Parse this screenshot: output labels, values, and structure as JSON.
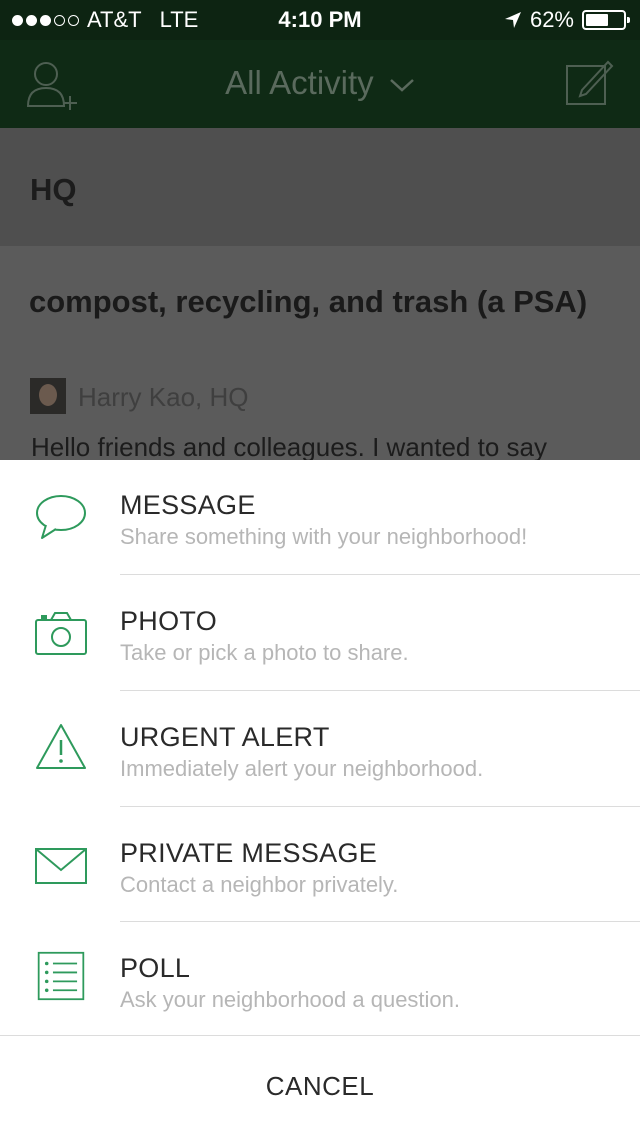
{
  "status_bar": {
    "carrier": "AT&T",
    "network": "LTE",
    "time": "4:10 PM",
    "battery_percent_label": "62%",
    "battery_level": 0.62,
    "signal_bars_filled": 3,
    "signal_bars_total": 5
  },
  "nav": {
    "title": "All Activity",
    "left_icon": "add-person-icon",
    "right_icon": "compose-icon"
  },
  "feed": {
    "group_name": "HQ",
    "post_title": "compost, recycling, and trash (a PSA)",
    "post_author": "Harry Kao, HQ",
    "post_body": "Hello friends and colleagues. I wanted to say"
  },
  "action_sheet": {
    "items": [
      {
        "icon": "speech-bubble-icon",
        "title": "MESSAGE",
        "subtitle": "Share something with your neighborhood!"
      },
      {
        "icon": "camera-icon",
        "title": "PHOTO",
        "subtitle": "Take or pick a photo to share."
      },
      {
        "icon": "warning-triangle-icon",
        "title": "URGENT ALERT",
        "subtitle": "Immediately alert your neighborhood."
      },
      {
        "icon": "envelope-icon",
        "title": "PRIVATE MESSAGE",
        "subtitle": "Contact a neighbor privately."
      },
      {
        "icon": "list-icon",
        "title": "POLL",
        "subtitle": "Ask your neighborhood a question."
      }
    ],
    "cancel_label": "CANCEL"
  },
  "colors": {
    "accent_green": "#2e9a5c",
    "navbar": "#0f2a15",
    "title_text": "#2a2a2a",
    "subtitle_text": "#b6b6b6"
  }
}
